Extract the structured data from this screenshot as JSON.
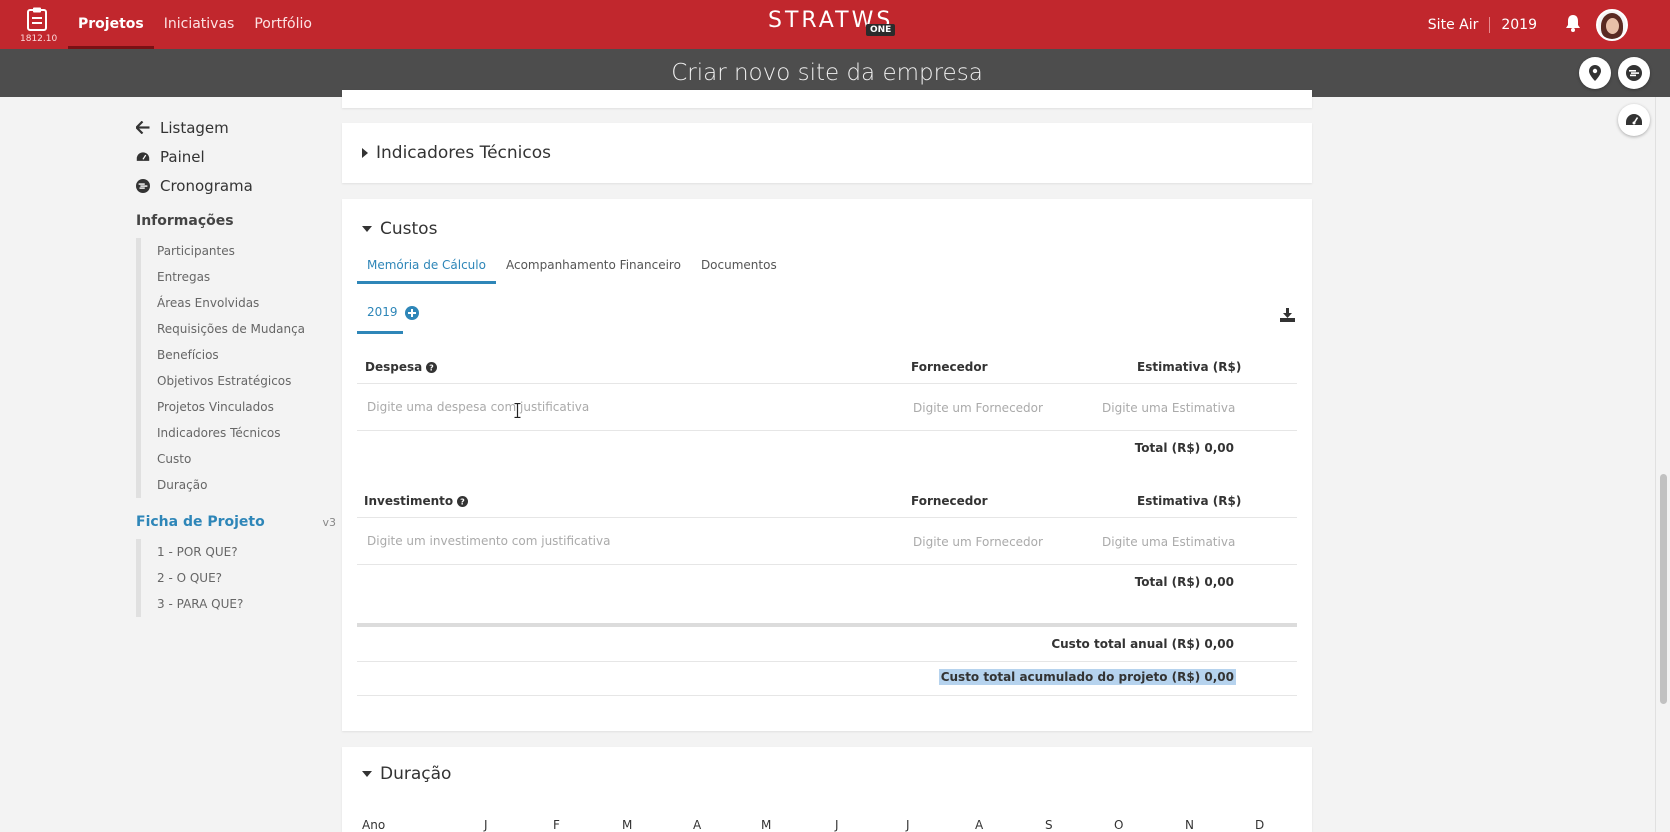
{
  "app": {
    "version": "1812.10",
    "brand": "STRATWS",
    "brand_badge": "ONE",
    "nav": [
      "Projetos",
      "Iniciativas",
      "Portfólio"
    ],
    "site": "Site Air",
    "year": "2019",
    "accent": "#c1272d",
    "link_color": "#2e86b8"
  },
  "page": {
    "title": "Criar novo site da empresa"
  },
  "sidebar": {
    "links": [
      {
        "label": "Listagem",
        "icon": "arrow-left-icon"
      },
      {
        "label": "Painel",
        "icon": "dashboard-icon"
      },
      {
        "label": "Cronograma",
        "icon": "timeline-icon"
      }
    ],
    "info_heading": "Informações",
    "info_items": [
      "Participantes",
      "Entregas",
      "Áreas Envolvidas",
      "Requisições de Mudança",
      "Benefícios",
      "Objetivos Estratégicos",
      "Projetos Vinculados",
      "Indicadores Técnicos",
      "Custo",
      "Duração"
    ],
    "ficha_heading": "Ficha de Projeto",
    "ficha_version": "v3",
    "ficha_items": [
      "1 - POR QUE?",
      "2 - O QUE?",
      "3 - PARA QUE?"
    ]
  },
  "sections": {
    "indicadores": "Indicadores Técnicos",
    "custos": "Custos",
    "duracao": "Duração"
  },
  "custos": {
    "tabs": [
      "Memória de Cálculo",
      "Acompanhamento Financeiro",
      "Documentos"
    ],
    "year_tab": "2019",
    "despesa": {
      "header": "Despesa",
      "fornecedor_header": "Fornecedor",
      "estimativa_header": "Estimativa (R$)",
      "placeholder": "Digite uma despesa com justificativa",
      "fornecedor_placeholder": "Digite um Fornecedor",
      "estimativa_placeholder": "Digite uma Estimativa",
      "total": "Total (R$) 0,00"
    },
    "investimento": {
      "header": "Investimento",
      "fornecedor_header": "Fornecedor",
      "estimativa_header": "Estimativa (R$)",
      "placeholder": "Digite um investimento com justificativa",
      "fornecedor_placeholder": "Digite um Fornecedor",
      "estimativa_placeholder": "Digite uma Estimativa",
      "total": "Total (R$) 0,00"
    },
    "custo_anual": "Custo total anual (R$) 0,00",
    "custo_acumulado": "Custo total acumulado do projeto (R$) 0,00"
  },
  "duracao": {
    "year_label": "Ano",
    "months": [
      "J",
      "F",
      "M",
      "A",
      "M",
      "J",
      "J",
      "A",
      "S",
      "O",
      "N",
      "D"
    ]
  }
}
